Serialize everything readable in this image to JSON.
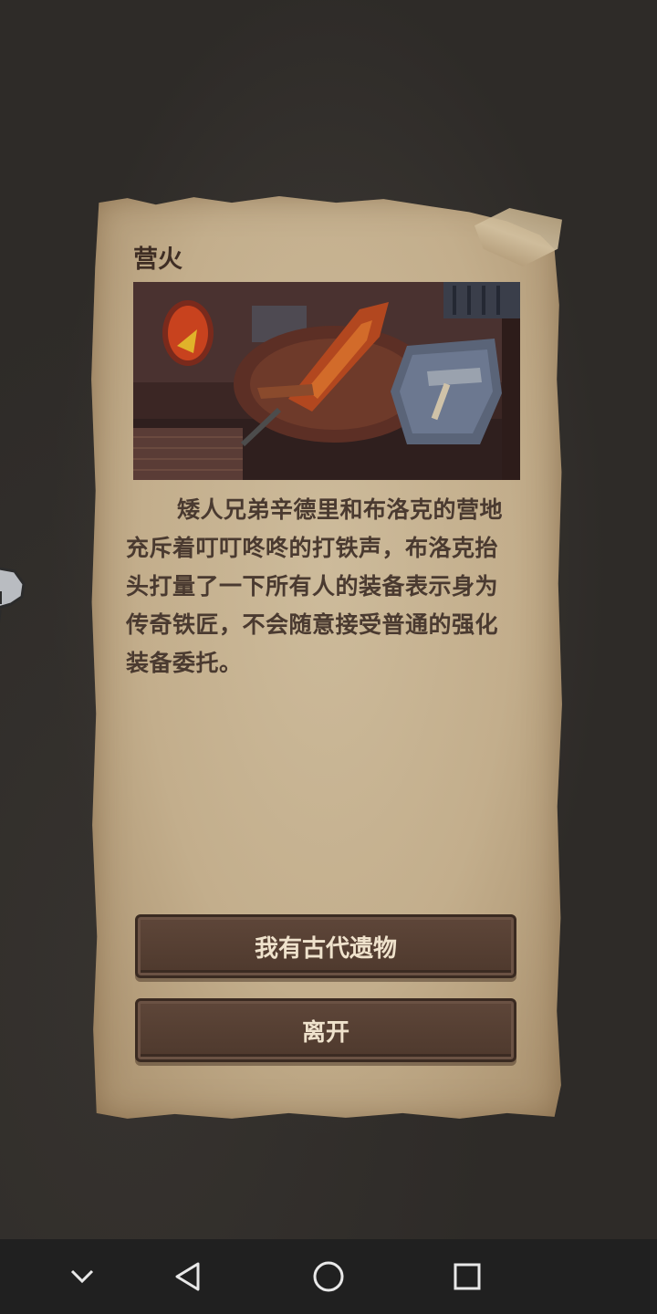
{
  "event": {
    "title": "营火",
    "story": "矮人兄弟辛德里和布洛克的营地充斥着叮叮咚咚的打铁声，布洛克抬头打量了一下所有人的装备表示身为传奇铁匠，不会随意接受普通的强化装备委托。",
    "scene_icon": "forge-anvil-scene",
    "choices": [
      {
        "label": "我有古代遗物"
      },
      {
        "label": "离开"
      }
    ]
  },
  "navbar": {
    "buttons": [
      "chevron-down-icon",
      "back-icon",
      "home-icon",
      "recents-icon"
    ]
  },
  "colors": {
    "parchment": "#c3ae8c",
    "button": "#56402f",
    "button_text": "#efe2cc",
    "title_text": "#3f2e24"
  }
}
